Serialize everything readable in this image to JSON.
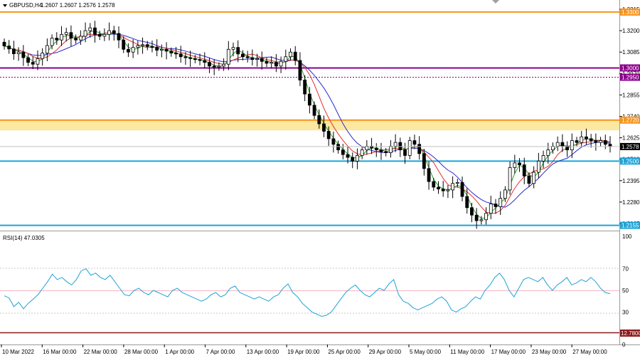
{
  "header": {
    "symbol": "GBPUSD,H4",
    "ohlc": "1.2607 1.2607 1.2576 1.2578"
  },
  "price_axis": {
    "ticks": [
      "1.3315",
      "1.3200",
      "1.3085",
      "1.2970",
      "1.2855",
      "1.2740",
      "1.2625",
      "1.2510",
      "1.2395",
      "1.2280",
      "1.2165"
    ]
  },
  "levels": [
    {
      "label": "1.3300",
      "price": 1.33,
      "color": "#f7941d",
      "style": "solid"
    },
    {
      "label": "1.3000",
      "price": 1.3,
      "color": "#8b008b",
      "style": "solid"
    },
    {
      "label": "1.2950",
      "price": 1.295,
      "color": "#8b008b",
      "style": "dotted"
    },
    {
      "label": "1.2720",
      "price": 1.272,
      "color": "#f7941d",
      "style": "solid"
    },
    {
      "label": "1.2500",
      "price": 1.25,
      "color": "#1fa3d6",
      "style": "solid"
    },
    {
      "label": "1.2155",
      "price": 1.2155,
      "color": "#1fa3d6",
      "style": "solid"
    }
  ],
  "zone": {
    "from": 1.2665,
    "to": 1.272,
    "color": "#fce8a0"
  },
  "current_price": {
    "label": "1.2578",
    "price": 1.2578
  },
  "rsi": {
    "title": "RSI(14) 47.0305",
    "ticks": [
      "100",
      "70",
      "50",
      "30",
      "0"
    ],
    "level_label": "12.7800"
  },
  "time_axis": {
    "labels": [
      "10 Mar 2022",
      "16 Mar 00:00",
      "22 Mar 00:00",
      "28 Mar 00:00",
      "1 Apr 00:00",
      "7 Apr 00:00",
      "13 Apr 00:00",
      "19 Apr 00:00",
      "25 Apr 00:00",
      "29 Apr 00:00",
      "5 May 00:00",
      "11 May 00:00",
      "17 May 00:00",
      "23 May 00:00",
      "27 May 00:00"
    ]
  },
  "chart_data": {
    "type": "candlestick",
    "title": "GBPUSD,H4",
    "ylim": [
      1.2125,
      1.3345
    ],
    "closes": [
      1.3118,
      1.3102,
      1.3076,
      1.3085,
      1.3055,
      1.303,
      1.302,
      1.305,
      1.308,
      1.312,
      1.316,
      1.315,
      1.318,
      1.319,
      1.316,
      1.315,
      1.317,
      1.32,
      1.3215,
      1.318,
      1.317,
      1.318,
      1.32,
      1.3185,
      1.315,
      1.31,
      1.3085,
      1.311,
      1.312,
      1.3125,
      1.3115,
      1.311,
      1.3095,
      1.31,
      1.309,
      1.308,
      1.3075,
      1.306,
      1.3055,
      1.305,
      1.3045,
      1.304,
      1.303,
      1.301,
      1.3005,
      1.301,
      1.302,
      1.31,
      1.311,
      1.3075,
      1.306,
      1.3055,
      1.3045,
      1.305,
      1.3035,
      1.3025,
      1.303,
      1.301,
      1.3035,
      1.306,
      1.3085,
      1.304,
      1.2935,
      1.286,
      1.28,
      1.2745,
      1.27,
      1.266,
      1.262,
      1.259,
      1.256,
      1.2535,
      1.252,
      1.25,
      1.253,
      1.256,
      1.258,
      1.257,
      1.256,
      1.255,
      1.2545,
      1.258,
      1.26,
      1.256,
      1.253,
      1.261,
      1.259,
      1.254,
      1.246,
      1.239,
      1.236,
      1.235,
      1.234,
      1.2345,
      1.238,
      1.2385,
      1.231,
      1.225,
      1.221,
      1.218,
      1.2185,
      1.222,
      1.227,
      1.2255,
      1.23,
      1.2345,
      1.2465,
      1.249,
      1.248,
      1.242,
      1.238,
      1.244,
      1.25,
      1.253,
      1.256,
      1.258,
      1.26,
      1.258,
      1.256,
      1.261,
      1.26,
      1.263,
      1.262,
      1.261,
      1.26,
      1.261,
      1.259,
      1.2578
    ],
    "ma_periods_note": "",
    "rsi_values": [
      45,
      43,
      35,
      39,
      33,
      38,
      42,
      46,
      52,
      58,
      65,
      60,
      62,
      58,
      55,
      60,
      68,
      70,
      64,
      66,
      62,
      60,
      64,
      58,
      52,
      46,
      45,
      50,
      52,
      48,
      46,
      50,
      48,
      46,
      44,
      50,
      52,
      48,
      46,
      44,
      42,
      40,
      42,
      46,
      48,
      44,
      46,
      52,
      54,
      48,
      46,
      44,
      42,
      44,
      42,
      40,
      44,
      46,
      52,
      56,
      48,
      44,
      38,
      34,
      30,
      28,
      26,
      27,
      30,
      36,
      42,
      48,
      52,
      55,
      50,
      46,
      44,
      48,
      52,
      50,
      56,
      60,
      46,
      40,
      38,
      34,
      32,
      34,
      36,
      38,
      42,
      44,
      40,
      32,
      30,
      33,
      35,
      40,
      44,
      42,
      50,
      55,
      62,
      66,
      60,
      50,
      44,
      52,
      60,
      62,
      60,
      58,
      62,
      55,
      50,
      55,
      58,
      62,
      55,
      57,
      60,
      58,
      62,
      58,
      52,
      48,
      47
    ]
  }
}
